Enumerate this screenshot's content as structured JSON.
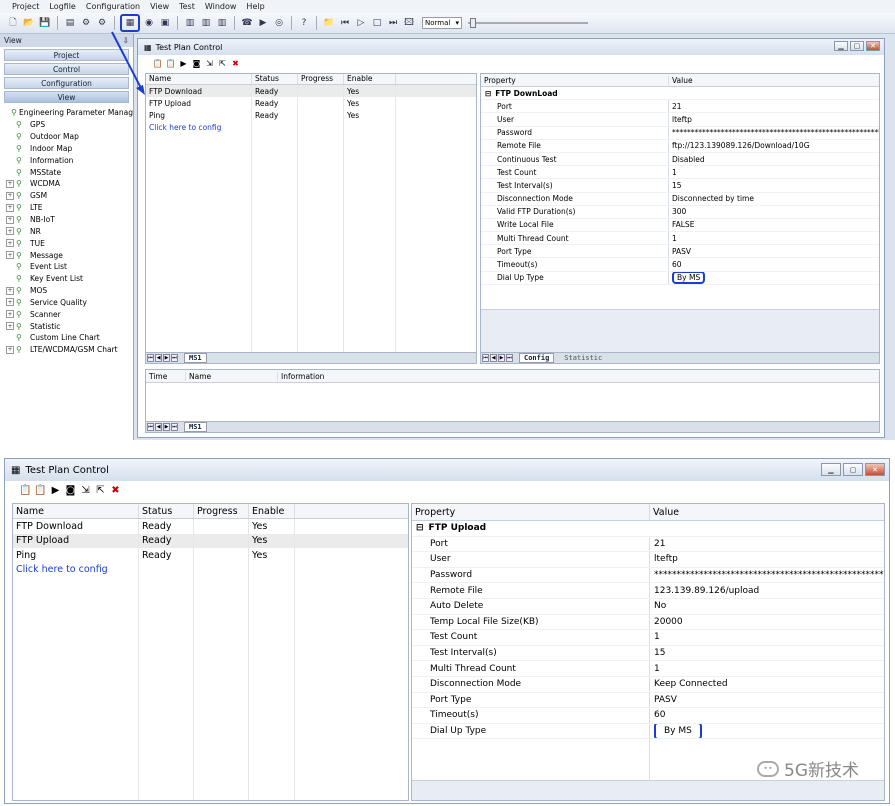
{
  "menu": [
    "Project",
    "Logfile",
    "Configuration",
    "View",
    "Test",
    "Window",
    "Help"
  ],
  "toolbar": {
    "speed_value": "Normal"
  },
  "left_panel": {
    "header": "View",
    "pin": "⇩",
    "nav": [
      "Project",
      "Control",
      "Configuration",
      "View"
    ],
    "tree": [
      {
        "label": "Engineering Parameter Manag",
        "exp": false
      },
      {
        "label": "GPS",
        "exp": false
      },
      {
        "label": "Outdoor Map",
        "exp": false
      },
      {
        "label": "Indoor Map",
        "exp": false
      },
      {
        "label": "Information",
        "exp": false
      },
      {
        "label": "MSState",
        "exp": false
      },
      {
        "label": "WCDMA",
        "exp": true
      },
      {
        "label": "GSM",
        "exp": true
      },
      {
        "label": "LTE",
        "exp": true
      },
      {
        "label": "NB-IoT",
        "exp": true
      },
      {
        "label": "NR",
        "exp": true
      },
      {
        "label": "TUE",
        "exp": true
      },
      {
        "label": "Message",
        "exp": true
      },
      {
        "label": "Event List",
        "exp": false
      },
      {
        "label": "Key Event List",
        "exp": false
      },
      {
        "label": "MOS",
        "exp": true
      },
      {
        "label": "Service Quality",
        "exp": true
      },
      {
        "label": "Scanner",
        "exp": true
      },
      {
        "label": "Statistic",
        "exp": true
      },
      {
        "label": "Custom Line Chart",
        "exp": false
      },
      {
        "label": "LTE/WCDMA/GSM Chart",
        "exp": true
      }
    ]
  },
  "window1": {
    "title": "Test Plan Control",
    "test_columns": [
      "Name",
      "Status",
      "Progress",
      "Enable"
    ],
    "tests": [
      {
        "name": "FTP Download",
        "status": "Ready",
        "progress": "",
        "enable": "Yes"
      },
      {
        "name": "FTP Upload",
        "status": "Ready",
        "progress": "",
        "enable": "Yes"
      },
      {
        "name": "Ping",
        "status": "Ready",
        "progress": "",
        "enable": "Yes"
      }
    ],
    "config_link": "Click here to config",
    "ms_tab": "MS1",
    "prop_columns": [
      "Property",
      "Value"
    ],
    "group": "FTP DownLoad",
    "props": [
      {
        "k": "Port",
        "v": "21"
      },
      {
        "k": "User",
        "v": "lteftp"
      },
      {
        "k": "Password",
        "v": "********************************************************"
      },
      {
        "k": "Remote File",
        "v": "ftp://123.139089.126/Download/10G"
      },
      {
        "k": "Continuous Test",
        "v": "Disabled"
      },
      {
        "k": "Test Count",
        "v": "1"
      },
      {
        "k": "Test Interval(s)",
        "v": "15"
      },
      {
        "k": "Disconnection Mode",
        "v": "Disconnected by time"
      },
      {
        "k": "Valid FTP Duration(s)",
        "v": "300"
      },
      {
        "k": "Write Local File",
        "v": "FALSE"
      },
      {
        "k": "Multi Thread Count",
        "v": "1"
      },
      {
        "k": "Port Type",
        "v": "PASV"
      },
      {
        "k": "Timeout(s)",
        "v": "60"
      },
      {
        "k": "Dial Up Type",
        "v": "By MS"
      }
    ],
    "prop_tabs": [
      "Config",
      "Statistic"
    ],
    "log_columns": [
      "Time",
      "Name",
      "Information"
    ],
    "log_tab": "MS1"
  },
  "window2": {
    "title": "Test Plan Control",
    "test_columns": [
      "Name",
      "Status",
      "Progress",
      "Enable"
    ],
    "tests": [
      {
        "name": "FTP Download",
        "status": "Ready",
        "progress": "",
        "enable": "Yes"
      },
      {
        "name": "FTP Upload",
        "status": "Ready",
        "progress": "",
        "enable": "Yes"
      },
      {
        "name": "Ping",
        "status": "Ready",
        "progress": "",
        "enable": "Yes"
      }
    ],
    "config_link": "Click here to config",
    "prop_columns": [
      "Property",
      "Value"
    ],
    "group": "FTP Upload",
    "props": [
      {
        "k": "Port",
        "v": "21"
      },
      {
        "k": "User",
        "v": "lteftp"
      },
      {
        "k": "Password",
        "v": "*****************************************************"
      },
      {
        "k": "Remote File",
        "v": "123.139.89.126/upload"
      },
      {
        "k": "Auto Delete",
        "v": "No"
      },
      {
        "k": "Temp Local File Size(KB)",
        "v": "20000"
      },
      {
        "k": "Test Count",
        "v": "1"
      },
      {
        "k": "Test Interval(s)",
        "v": "15"
      },
      {
        "k": "Multi Thread Count",
        "v": "1"
      },
      {
        "k": "Disconnection Mode",
        "v": "Keep Connected"
      },
      {
        "k": "Port Type",
        "v": "PASV"
      },
      {
        "k": "Timeout(s)",
        "v": "60"
      },
      {
        "k": "Dial Up Type",
        "v": "By MS"
      }
    ]
  },
  "watermark": "5G新技术",
  "colors": {
    "highlight": "#1a3fd0",
    "link": "#1a3fd0"
  }
}
